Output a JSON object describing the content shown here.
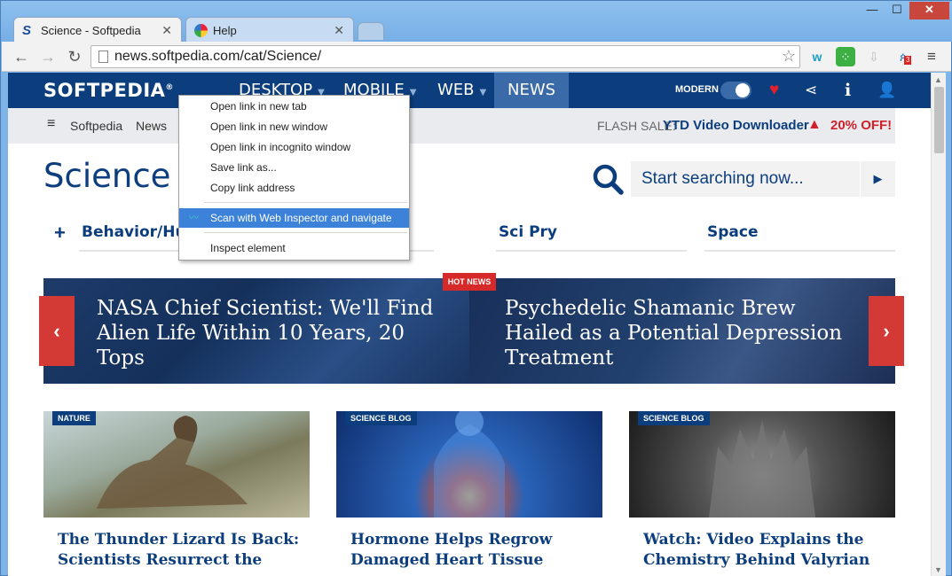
{
  "browser": {
    "tabs": [
      {
        "title": "Science - Softpedia",
        "favicon": "softpedia-s-icon"
      },
      {
        "title": "Help",
        "favicon": "chrome-help-icon"
      }
    ],
    "url": "news.softpedia.com/cat/Science/",
    "extension_badge": "3"
  },
  "site": {
    "logo": "SOFTPEDIA",
    "logo_mark": "®",
    "nav": [
      "DESKTOP",
      "MOBILE",
      "WEB",
      "NEWS"
    ],
    "modern_label": "MODERN",
    "breadcrumb": [
      "Softpedia",
      "News"
    ],
    "flash_label": "FLASH SALE:",
    "flash_title": "YTD Video Downloader",
    "flash_discount": "20% OFF!",
    "page_title": "Science",
    "search_placeholder": "Start searching now...",
    "categories": [
      "Behavior/Hur",
      "Sci Pry",
      "Space"
    ],
    "hot_news_badge": "HOT NEWS",
    "slides": [
      "NASA Chief Scientist: We'll Find Alien Life Within 10 Years, 20 Tops",
      "Psychedelic Shamanic Brew Hailed as a Potential Depression Treatment"
    ],
    "cards": [
      {
        "tag": "NATURE",
        "title": "The Thunder Lizard Is Back: Scientists Resurrect the"
      },
      {
        "tag": "SCIENCE BLOG",
        "title": "Hormone Helps Regrow Damaged Heart Tissue"
      },
      {
        "tag": "SCIENCE BLOG",
        "title": "Watch: Video Explains the Chemistry Behind Valyrian"
      }
    ]
  },
  "context_menu": {
    "items": [
      "Open link in new tab",
      "Open link in new window",
      "Open link in incognito window",
      "Save link as...",
      "Copy link address",
      "Scan with Web Inspector and navigate",
      "Inspect element"
    ],
    "highlighted_index": 5
  },
  "colors": {
    "brand": "#0c3d7d",
    "accent_red": "#d33a35",
    "highlight": "#3d82d9"
  }
}
